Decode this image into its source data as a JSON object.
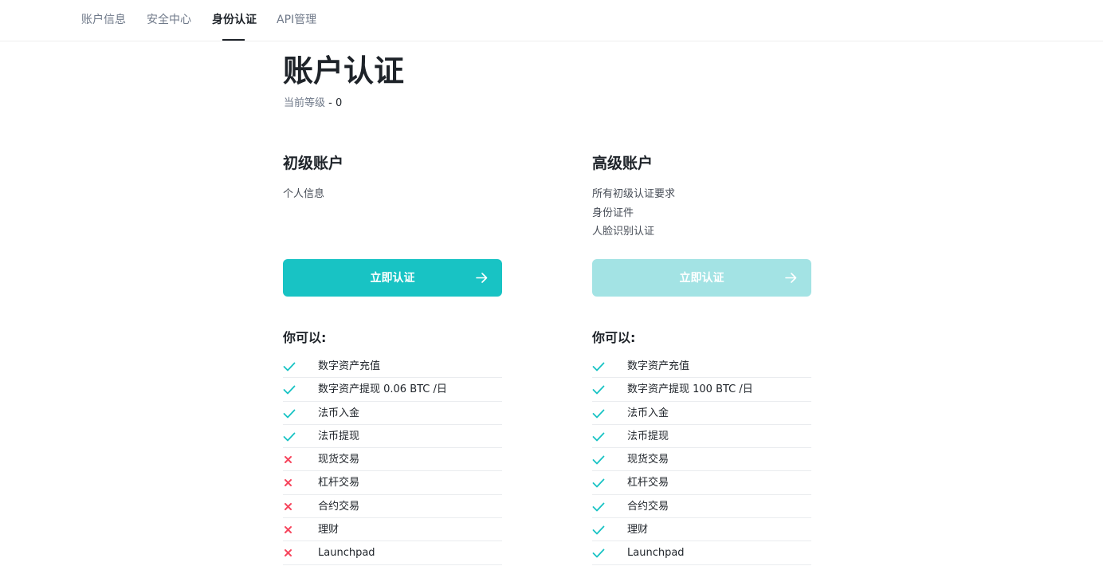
{
  "nav": {
    "tabs": [
      {
        "label": "账户信息",
        "active": false
      },
      {
        "label": "安全中心",
        "active": false
      },
      {
        "label": "身份认证",
        "active": true
      },
      {
        "label": "API管理",
        "active": false
      }
    ]
  },
  "page": {
    "title": "账户认证",
    "level_label": "当前等级",
    "level_value": "- 0"
  },
  "columns": [
    {
      "title": "初级账户",
      "requirements": [
        "个人信息"
      ],
      "button": {
        "label": "立即认证",
        "state": "enabled"
      },
      "can_title": "你可以:",
      "permissions": [
        {
          "label": "数字资产充值",
          "status": "check"
        },
        {
          "label": "数字资产提现 0.06 BTC /日",
          "status": "check"
        },
        {
          "label": "法币入金",
          "status": "check"
        },
        {
          "label": "法币提现",
          "status": "check"
        },
        {
          "label": "现货交易",
          "status": "cross"
        },
        {
          "label": "杠杆交易",
          "status": "cross"
        },
        {
          "label": "合约交易",
          "status": "cross"
        },
        {
          "label": "理财",
          "status": "cross"
        },
        {
          "label": "Launchpad",
          "status": "cross"
        }
      ]
    },
    {
      "title": "高级账户",
      "requirements": [
        "所有初级认证要求",
        "身份证件",
        "人脸识别认证"
      ],
      "button": {
        "label": "立即认证",
        "state": "disabled"
      },
      "can_title": "你可以:",
      "permissions": [
        {
          "label": "数字资产充值",
          "status": "check"
        },
        {
          "label": "数字资产提现 100 BTC /日",
          "status": "check"
        },
        {
          "label": "法币入金",
          "status": "check"
        },
        {
          "label": "法币提现",
          "status": "check"
        },
        {
          "label": "现货交易",
          "status": "check"
        },
        {
          "label": "杠杆交易",
          "status": "check"
        },
        {
          "label": "合约交易",
          "status": "check"
        },
        {
          "label": "理财",
          "status": "check"
        },
        {
          "label": "Launchpad",
          "status": "check"
        }
      ]
    }
  ],
  "colors": {
    "accent": "#18c3c4",
    "accent_disabled": "#a3e3e4",
    "check": "#18c3c4",
    "cross": "#f6465d"
  }
}
